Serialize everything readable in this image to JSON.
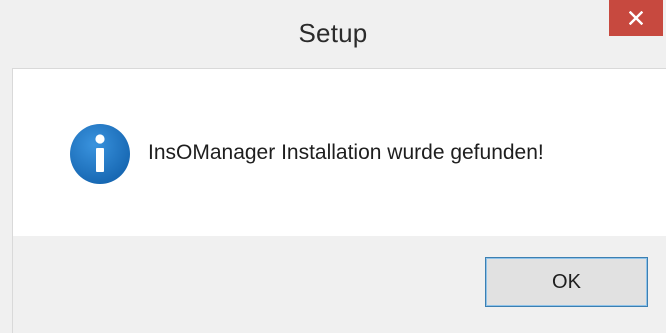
{
  "window": {
    "title": "Setup",
    "close_icon": "close-icon"
  },
  "dialog": {
    "icon": "info-icon",
    "message": "InsOManager Installation wurde gefunden!"
  },
  "buttons": {
    "ok_label": "OK"
  },
  "colors": {
    "close_button": "#c7493f",
    "info_icon": "#1e73be",
    "ok_border": "#3c7fb1"
  }
}
